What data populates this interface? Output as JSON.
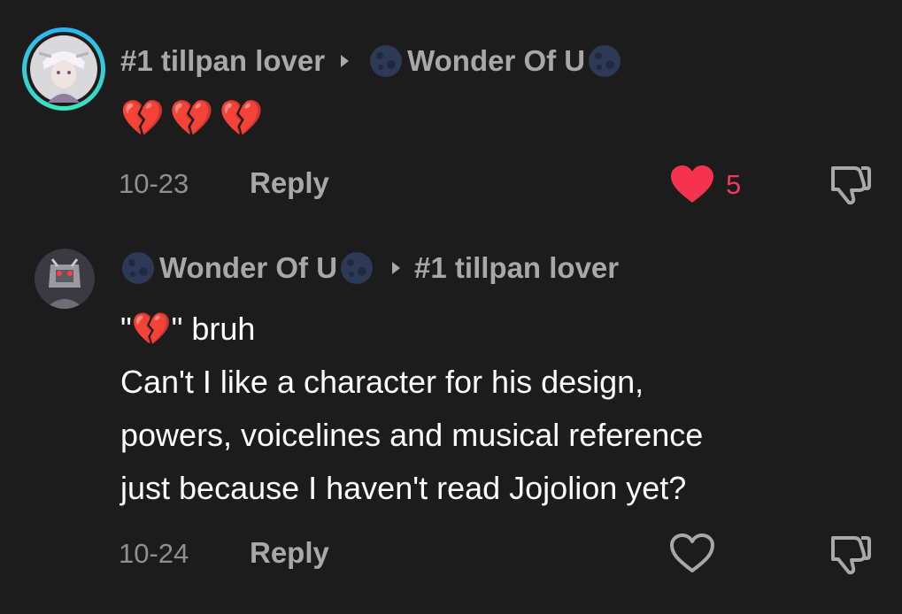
{
  "comments": [
    {
      "author": "#1 tillpan lover",
      "reply_to": "Wonder Of U",
      "text_lines": [
        "💔💔💔"
      ],
      "date": "10-23",
      "reply_label": "Reply",
      "likes": "5",
      "liked": true
    },
    {
      "author": "Wonder Of U",
      "reply_to": "#1 tillpan lover",
      "text_lines": [
        "\"💔\" bruh",
        "Can't I like a character for his design,",
        "powers, voicelines and musical reference",
        "just because I haven't read Jojolion yet?"
      ],
      "date": "10-24",
      "reply_label": "Reply",
      "likes": "",
      "liked": false
    }
  ],
  "icons": {
    "moon": "moon-emoji-icon",
    "like": "heart-icon",
    "dislike": "thumbs-down-icon",
    "separator": "triangle-arrow-icon"
  },
  "colors": {
    "background": "#1c1c1c",
    "liked_heart": "#f5334f",
    "muted_text": "#a8a8a8",
    "avatar_ring_start": "#2ab3f7",
    "avatar_ring_end": "#3fe6b8"
  }
}
